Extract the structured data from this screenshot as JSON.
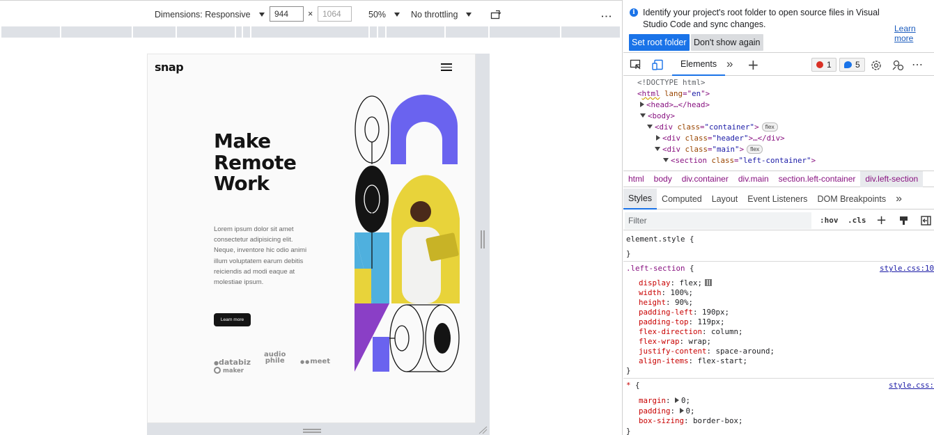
{
  "device_toolbar": {
    "dimensions_label": "Dimensions: Responsive",
    "width_value": "944",
    "height_placeholder": "1064",
    "times": "×",
    "zoom": "50%",
    "throttling": "No throttling",
    "more": "⋮"
  },
  "page": {
    "logo": "snap",
    "hero_title_line1": "Make",
    "hero_title_line2": "Remote",
    "hero_title_line3": "Work",
    "hero_text": "Lorem ipsum dolor sit amet consectetur adipisicing elit. Neque, inventore hic odio animi illum voluptatem earum debitis reiciendis ad modi eaque at molestiae ipsum.",
    "learn_more": "Learn more",
    "clients": {
      "databiz": "databiz",
      "audiophile_1": "audio",
      "audiophile_2": "phile",
      "meet": "meet",
      "maker": "maker"
    }
  },
  "banner": {
    "message": "Identify your project's root folder to open source files in Visual Studio Code and sync changes.",
    "learn_more": "Learn more",
    "set_root": "Set root folder",
    "dont_show": "Don't show again"
  },
  "devtools_tabs": {
    "elements": "Elements",
    "more": "»",
    "errors": "1",
    "messages": "5"
  },
  "dom": {
    "doctype": "<!DOCTYPE html>",
    "l2_tag_open": "<",
    "l2_tag": "html",
    "l2_attr": "lang",
    "l2_eq": "=\"",
    "l2_val": "en",
    "l2_close": "\">",
    "l3": "<head>…</head>",
    "l4": "<body>",
    "l5_tag": "<div",
    "l5_attr": " class",
    "l5_val": "\"container\"",
    "l5_end": ">",
    "l5_pill": "flex",
    "l6_tag": "<div",
    "l6_attr": " class",
    "l6_val": "\"header\"",
    "l6_end": ">…</div>",
    "l7_tag": "<div",
    "l7_attr": " class",
    "l7_val": "\"main\"",
    "l7_end": ">",
    "l7_pill": "flex",
    "l8_tag": "<section",
    "l8_attr": " class",
    "l8_val": "\"left-container\"",
    "l8_end": ">"
  },
  "breadcrumbs": [
    "html",
    "body",
    "div.container",
    "div.main",
    "section.left-container",
    "div.left-section"
  ],
  "style_tabs": [
    "Styles",
    "Computed",
    "Layout",
    "Event Listeners",
    "DOM Breakpoints"
  ],
  "style_tabs_more": "»",
  "filter": {
    "placeholder": "Filter",
    "hov": ":hov",
    "cls": ".cls"
  },
  "styles": {
    "element_style": "element.style {",
    "close": "}",
    "rule1_selector": ".left-section",
    "rule1_brace": " {",
    "rule1_source": "style.css:10",
    "rule1_props": [
      {
        "name": "display",
        "value": "flex;"
      },
      {
        "name": "width",
        "value": "100%;"
      },
      {
        "name": "height",
        "value": "90%;"
      },
      {
        "name": "padding-left",
        "value": "190px;"
      },
      {
        "name": "padding-top",
        "value": "119px;"
      },
      {
        "name": "flex-direction",
        "value": "column;"
      },
      {
        "name": "flex-wrap",
        "value": "wrap;"
      },
      {
        "name": "justify-content",
        "value": "space-around;"
      },
      {
        "name": "align-items",
        "value": "flex-start;"
      }
    ],
    "rule2_selector": "*",
    "rule2_brace": " {",
    "rule2_source": "style.css:",
    "rule2_props": [
      {
        "name": "margin",
        "value": "0;"
      },
      {
        "name": "padding",
        "value": "0;"
      },
      {
        "name": "box-sizing",
        "value": "border-box;"
      }
    ]
  },
  "colors": {
    "accent": "#1a73e8",
    "art_purple": "#6a63ef",
    "art_yellow": "#e8d33a",
    "art_cyan": "#4fb0de",
    "art_violet": "#8a3fc6"
  }
}
